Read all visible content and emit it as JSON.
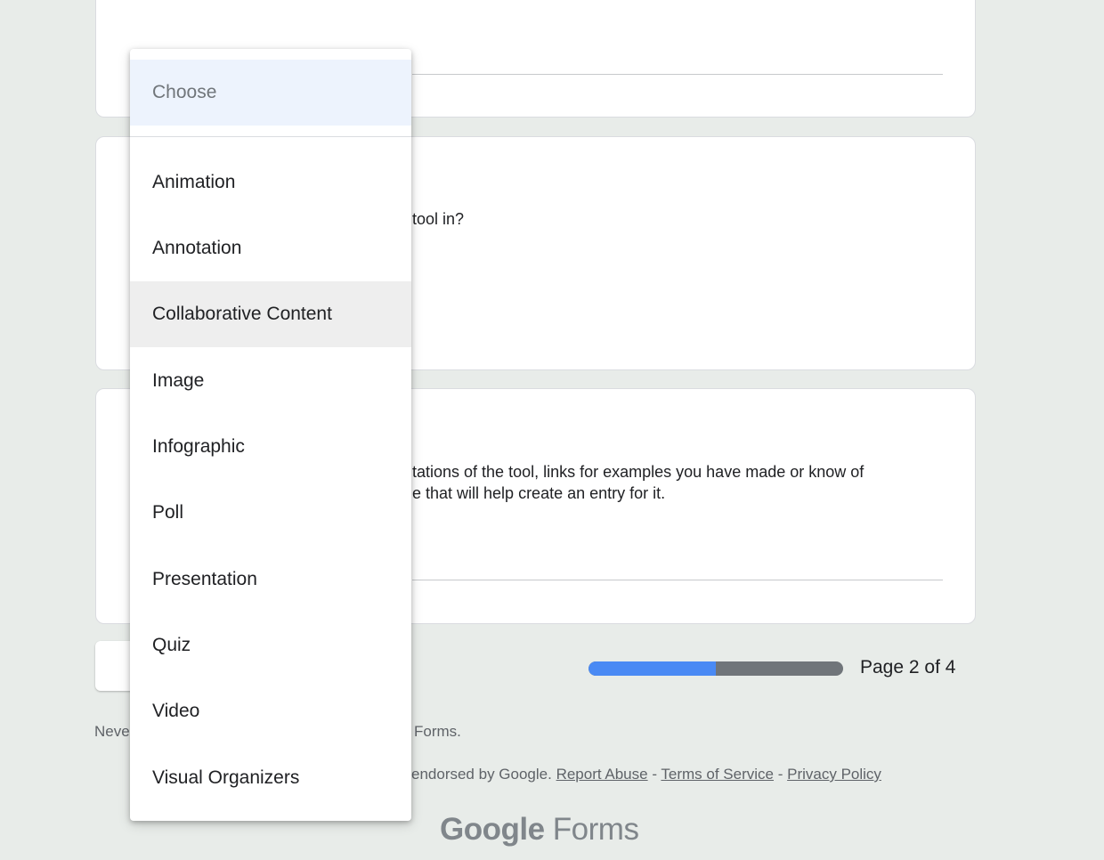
{
  "questions": [
    {
      "visible_text_line1": "tool in?"
    },
    {
      "visible_text_line1": "tations of the tool, links for examples you have made or know of",
      "visible_text_line2": "e that will help create an entry for it."
    }
  ],
  "progress": {
    "fraction": 0.5,
    "page_label": "Page 2 of 4"
  },
  "footer": {
    "line1": "Neve",
    "line1_right": "Forms.",
    "line2": "endorsed by Google.",
    "links": [
      "Report Abuse",
      "Terms of Service",
      "Privacy Policy"
    ],
    "separator": " - "
  },
  "brand": {
    "google": "Google",
    "forms": "Forms"
  },
  "dropdown": {
    "placeholder": "Choose",
    "options": [
      "Animation",
      "Annotation",
      "Collaborative Content",
      "Image",
      "Infographic",
      "Poll",
      "Presentation",
      "Quiz",
      "Video",
      "Visual Organizers"
    ],
    "hovered_option": "Collaborative Content"
  },
  "colors": {
    "accent": "#4a8af4",
    "progress_track": "#70757a",
    "choose_bg": "#edf3fd"
  }
}
